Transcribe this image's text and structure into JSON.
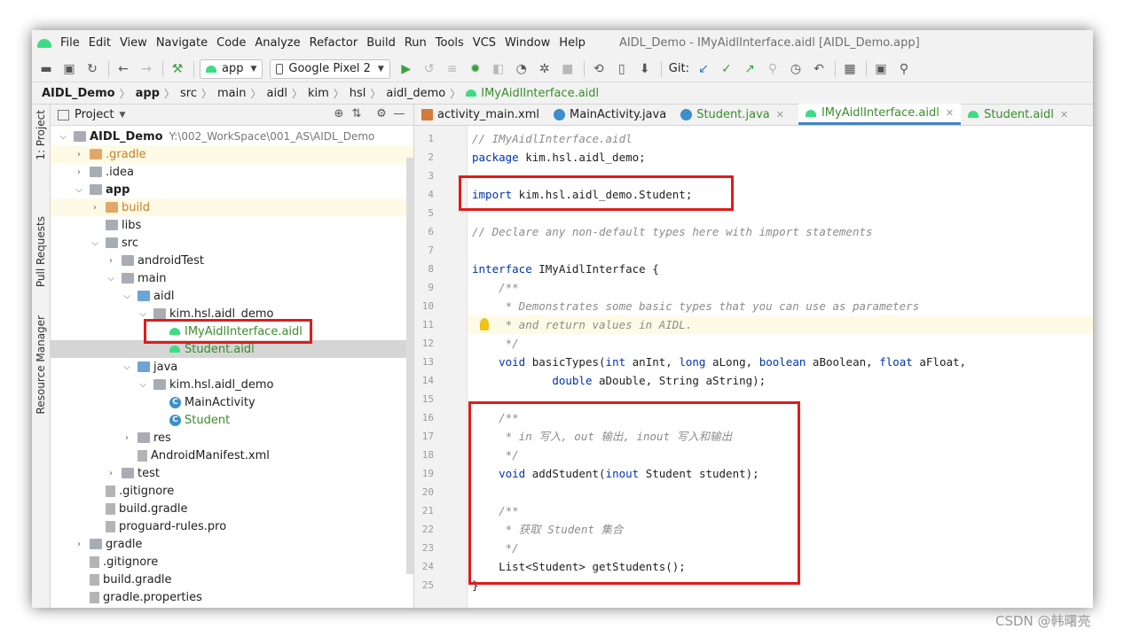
{
  "menubar": {
    "items": [
      "File",
      "Edit",
      "View",
      "Navigate",
      "Code",
      "Analyze",
      "Refactor",
      "Build",
      "Run",
      "Tools",
      "VCS",
      "Window",
      "Help"
    ],
    "window_title": "AIDL_Demo - IMyAidlInterface.aidl [AIDL_Demo.app]"
  },
  "toolbar": {
    "run_config": "app",
    "device": "Google Pixel 2",
    "git_label": "Git:"
  },
  "breadcrumb": [
    "AIDL_Demo",
    "app",
    "src",
    "main",
    "aidl",
    "kim",
    "hsl",
    "aidl_demo",
    "IMyAidlInterface.aidl"
  ],
  "toolstrip": {
    "project": "1: Project",
    "pull_requests": "Pull Requests",
    "resource_manager": "Resource Manager"
  },
  "project_panel": {
    "title": "Project",
    "root_path": "Y:\\002_WorkSpace\\001_AS\\AIDL_Demo",
    "tree": [
      {
        "label": "AIDL_Demo",
        "depth": 0,
        "arrow": "v",
        "icon": "folder",
        "bold": true
      },
      {
        "label": ".gradle",
        "depth": 1,
        "arrow": ">",
        "icon": "folder-orange",
        "style": "orange",
        "bg": "yellow"
      },
      {
        "label": ".idea",
        "depth": 1,
        "arrow": ">",
        "icon": "folder"
      },
      {
        "label": "app",
        "depth": 1,
        "arrow": "v",
        "icon": "folder",
        "bold": true
      },
      {
        "label": "build",
        "depth": 2,
        "arrow": ">",
        "icon": "folder-orange",
        "style": "orange",
        "bg": "yellow"
      },
      {
        "label": "libs",
        "depth": 2,
        "arrow": "",
        "icon": "folder"
      },
      {
        "label": "src",
        "depth": 2,
        "arrow": "v",
        "icon": "folder"
      },
      {
        "label": "androidTest",
        "depth": 3,
        "arrow": ">",
        "icon": "folder"
      },
      {
        "label": "main",
        "depth": 3,
        "arrow": "v",
        "icon": "folder"
      },
      {
        "label": "aidl",
        "depth": 4,
        "arrow": "v",
        "icon": "folder-blue"
      },
      {
        "label": "kim.hsl.aidl_demo",
        "depth": 5,
        "arrow": "v",
        "icon": "pkg"
      },
      {
        "label": "IMyAidlInterface.aidl",
        "depth": 6,
        "arrow": "",
        "icon": "android",
        "style": "green"
      },
      {
        "label": "Student.aidl",
        "depth": 6,
        "arrow": "",
        "icon": "android",
        "style": "green",
        "bg": "selected"
      },
      {
        "label": "java",
        "depth": 4,
        "arrow": "v",
        "icon": "folder-blue"
      },
      {
        "label": "kim.hsl.aidl_demo",
        "depth": 5,
        "arrow": "v",
        "icon": "pkg"
      },
      {
        "label": "MainActivity",
        "depth": 6,
        "arrow": "",
        "icon": "class"
      },
      {
        "label": "Student",
        "depth": 6,
        "arrow": "",
        "icon": "class",
        "style": "green"
      },
      {
        "label": "res",
        "depth": 4,
        "arrow": ">",
        "icon": "folder"
      },
      {
        "label": "AndroidManifest.xml",
        "depth": 4,
        "arrow": "",
        "icon": "file"
      },
      {
        "label": "test",
        "depth": 3,
        "arrow": ">",
        "icon": "folder"
      },
      {
        "label": ".gitignore",
        "depth": 2,
        "arrow": "",
        "icon": "file"
      },
      {
        "label": "build.gradle",
        "depth": 2,
        "arrow": "",
        "icon": "file"
      },
      {
        "label": "proguard-rules.pro",
        "depth": 2,
        "arrow": "",
        "icon": "file"
      },
      {
        "label": "gradle",
        "depth": 1,
        "arrow": ">",
        "icon": "folder"
      },
      {
        "label": ".gitignore",
        "depth": 1,
        "arrow": "",
        "icon": "file"
      },
      {
        "label": "build.gradle",
        "depth": 1,
        "arrow": "",
        "icon": "file"
      },
      {
        "label": "gradle.properties",
        "depth": 1,
        "arrow": "",
        "icon": "file"
      }
    ]
  },
  "editor": {
    "tabs": [
      {
        "label": "activity_main.xml",
        "icon": "xml",
        "active": false
      },
      {
        "label": "MainActivity.java",
        "icon": "class",
        "active": false
      },
      {
        "label": "Student.java",
        "icon": "class",
        "active": false,
        "style": "green"
      },
      {
        "label": "IMyAidlInterface.aidl",
        "icon": "android",
        "active": true,
        "style": "green"
      },
      {
        "label": "Student.aidl",
        "icon": "android",
        "active": false,
        "style": "green"
      }
    ],
    "caret_line": 11,
    "lines": [
      {
        "n": "1",
        "text": "// IMyAidlInterface.aidl",
        "kind": "comment"
      },
      {
        "n": "2",
        "kw": "package",
        "text": " kim.hsl.aidl_demo;"
      },
      {
        "n": "3",
        "text": ""
      },
      {
        "n": "4",
        "kw": "import",
        "text": " kim.hsl.aidl_demo.Student;"
      },
      {
        "n": "5",
        "text": ""
      },
      {
        "n": "6",
        "text": "// Declare any non-default types here with import statements",
        "kind": "comment"
      },
      {
        "n": "7",
        "text": ""
      },
      {
        "n": "8",
        "kw": "interface",
        "text": " IMyAidlInterface {"
      },
      {
        "n": "9",
        "text": "    /**",
        "kind": "comment"
      },
      {
        "n": "10",
        "text": "     * Demonstrates some basic types that you can use as parameters",
        "kind": "comment"
      },
      {
        "n": "11",
        "text": "     * and return values in AIDL.",
        "kind": "comment"
      },
      {
        "n": "12",
        "text": "     */",
        "kind": "comment"
      },
      {
        "n": "13",
        "text": "    void basicTypes(int anInt, long aLong, boolean aBoolean, float aFloat,",
        "kind": "mixed"
      },
      {
        "n": "14",
        "text": "            double aDouble, String aString);",
        "kind": "mixed"
      },
      {
        "n": "15",
        "text": ""
      },
      {
        "n": "16",
        "text": "    /**",
        "kind": "comment"
      },
      {
        "n": "17",
        "text": "     * in 写入, out 输出, inout 写入和输出",
        "kind": "comment"
      },
      {
        "n": "18",
        "text": "     */",
        "kind": "comment"
      },
      {
        "n": "19",
        "text": "    void addStudent(inout Student student);",
        "kind": "mixed"
      },
      {
        "n": "20",
        "text": ""
      },
      {
        "n": "21",
        "text": "    /**",
        "kind": "comment"
      },
      {
        "n": "22",
        "text": "     * 获取 Student 集合",
        "kind": "comment"
      },
      {
        "n": "23",
        "text": "     */",
        "kind": "comment"
      },
      {
        "n": "24",
        "text": "    List<Student> getStudents();"
      },
      {
        "n": "25",
        "text": "}"
      }
    ]
  },
  "watermark": "CSDN @韩曙亮",
  "colors": {
    "keyword": "#0033b3",
    "comment": "#8c8c8c",
    "highlight_box": "#e01b1b",
    "android_green": "#3ddc84",
    "active_tab_underline": "#4083c9"
  }
}
